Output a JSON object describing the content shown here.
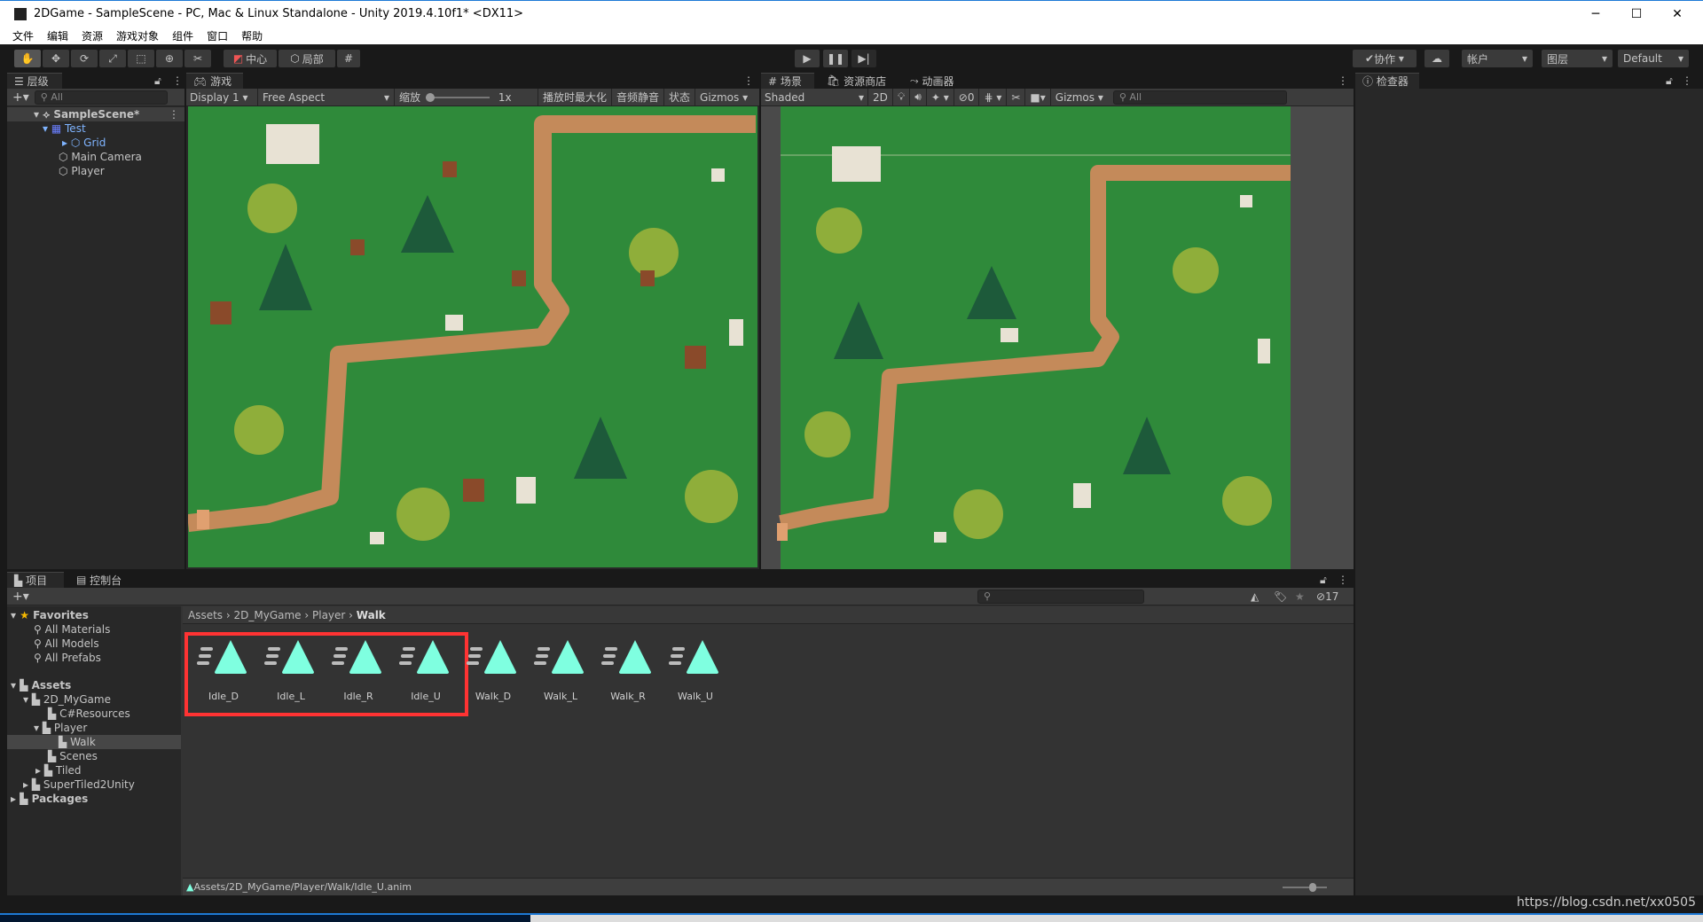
{
  "window": {
    "title": "2DGame - SampleScene - PC, Mac & Linux Standalone - Unity 2019.4.10f1* <DX11>",
    "minimize": "─",
    "maximize": "☐",
    "close": "✕"
  },
  "menu": [
    "文件",
    "编辑",
    "资源",
    "游戏对象",
    "组件",
    "窗口",
    "帮助"
  ],
  "toolbar": {
    "tools": [
      "hand-tool",
      "move-tool",
      "rotate-tool",
      "scale-tool",
      "rect-tool",
      "transform-tool",
      "custom-tool"
    ],
    "pivot": "中心",
    "space": "局部",
    "collab": "协作",
    "account": "帐户",
    "layers": "图层",
    "layout": "Default"
  },
  "hierarchy": {
    "tab": "层级",
    "search_placeholder": "All",
    "scene": "SampleScene*",
    "items": [
      "Test",
      "Grid",
      "Main Camera",
      "Player"
    ]
  },
  "game": {
    "tab": "游戏",
    "display": "Display 1",
    "aspect": "Free Aspect",
    "scale_label": "缩放",
    "scale_value": "1x",
    "maximize": "播放时最大化",
    "mute": "音频静音",
    "stats": "状态",
    "gizmos": "Gizmos"
  },
  "scene": {
    "tabs": [
      "场景",
      "资源商店",
      "动画器"
    ],
    "shading": "Shaded",
    "mode2d": "2D",
    "hidden_count": "0",
    "gizmos": "Gizmos",
    "search_placeholder": "All"
  },
  "inspector": {
    "tab": "检查器"
  },
  "project": {
    "tabs": [
      "项目",
      "控制台"
    ],
    "hidden_count": "17",
    "favorites": {
      "label": "Favorites",
      "items": [
        "All Materials",
        "All Models",
        "All Prefabs"
      ]
    },
    "assets_tree": {
      "label": "Assets",
      "items": [
        "2D_MyGame",
        "C#Resources",
        "Player",
        "Walk",
        "Scenes",
        "Tiled",
        "SuperTiled2Unity"
      ]
    },
    "packages": "Packages",
    "breadcrumb": [
      "Assets",
      "2D_MyGame",
      "Player",
      "Walk"
    ],
    "assets": [
      "Idle_D",
      "Idle_L",
      "Idle_R",
      "Idle_U",
      "Walk_D",
      "Walk_L",
      "Walk_R",
      "Walk_U"
    ],
    "selected_path": "Assets/2D_MyGame/Player/Walk/Idle_U.anim"
  },
  "watermark": "https://blog.csdn.net/xx0505",
  "colors": {
    "highlight_box": "#ff3333",
    "anim_icon": "#7fffe0",
    "grass": "#2f8a3a",
    "path": "#c48a5a",
    "accent_link": "#7fb4ff"
  }
}
